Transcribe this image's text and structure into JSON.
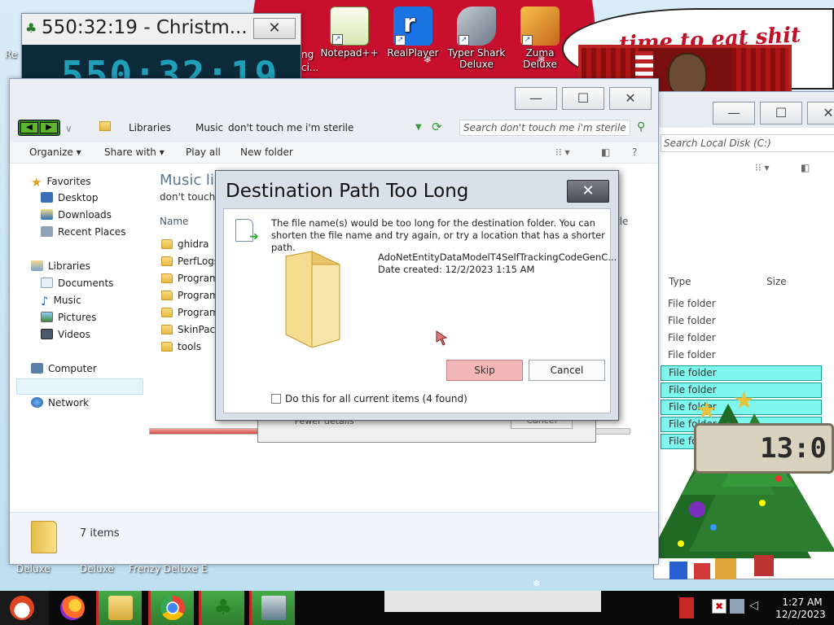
{
  "timer_widget": {
    "title": "550:32:19 - Christm...",
    "display": "550:32:19",
    "close_glyph": "✕"
  },
  "desktop_icons": [
    {
      "label": "Notepad++",
      "icon": "notepad-plus-plus-icon",
      "color": "#6aa84f"
    },
    {
      "label": "RealPlayer",
      "icon": "realplayer-icon",
      "color": "#1b74e4"
    },
    {
      "label": "Typer Shark Deluxe",
      "icon": "typer-shark-icon",
      "color": "#8a96a3"
    },
    {
      "label": "Zuma Deluxe",
      "icon": "zuma-deluxe-icon",
      "color": "#e08a2a"
    }
  ],
  "desktop_partial_labels": [
    "Re",
    "ng",
    "ci..."
  ],
  "bottom_icon_labels": [
    "Deluxe",
    "Deluxe",
    "Frenzy Deluxe",
    "E"
  ],
  "bubble_text": "time to eat shit",
  "back_window": {
    "search_placeholder": "Search Local Disk (C:)",
    "columns": [
      "Type",
      "Size"
    ],
    "rows": [
      {
        "type": "File folder",
        "selected": false
      },
      {
        "type": "File folder",
        "selected": false
      },
      {
        "type": "File folder",
        "selected": false
      },
      {
        "type": "File folder",
        "selected": false
      },
      {
        "type": "File folder",
        "selected": true
      },
      {
        "type": "File folder",
        "selected": true
      },
      {
        "type": "File folder",
        "selected": true
      },
      {
        "type": "File folder",
        "selected": true
      },
      {
        "type": "File folder",
        "selected": true
      }
    ],
    "selection_color": "#7ef7ee"
  },
  "main_window": {
    "breadcrumb": [
      "Libraries",
      "Music",
      "don't touch me i'm sterile"
    ],
    "search_placeholder": "Search don't touch me i'm sterile",
    "toolbar": {
      "organize": "Organize",
      "share_with": "Share with",
      "play_all": "Play all",
      "new_folder": "New folder"
    },
    "nav": {
      "favorites": "Favorites",
      "desktop": "Desktop",
      "downloads": "Downloads",
      "recent_places": "Recent Places",
      "libraries": "Libraries",
      "documents": "Documents",
      "music": "Music",
      "pictures": "Pictures",
      "videos": "Videos",
      "computer": "Computer",
      "network": "Network"
    },
    "library_title": "Music lib",
    "library_sub": "don't touch",
    "column_name": "Name",
    "column_partial": "tle",
    "files": [
      "ghidra",
      "PerfLogs",
      "Program",
      "Program",
      "Program",
      "SkinPack",
      "tools"
    ],
    "status": "7 items",
    "copy_progress": 0.88
  },
  "copy_dialog_bg": {
    "fewer_details": "Fewer details",
    "cancel": "Cancel"
  },
  "dialog": {
    "title": "Destination Path Too Long",
    "close_glyph": "✕",
    "message": "The file name(s) would be too long for the destination folder.  You can shorten the file name and try again, or try a location that has a shorter path.",
    "filename": "AdoNetEntityDataModelT4SelfTrackingCodeGenC...",
    "date_created": "Date created: 12/2/2023 1:15 AM",
    "skip": "Skip",
    "cancel": "Cancel",
    "checkbox_label": "Do this for all current items (4 found)",
    "checkbox_checked": false
  },
  "taskbar": {
    "apps": [
      {
        "icon": "santa-start-icon"
      },
      {
        "icon": "firefox-icon"
      },
      {
        "icon": "file-explorer-icon",
        "active": true
      },
      {
        "icon": "chrome-icon",
        "active": true
      },
      {
        "icon": "christmas-tree-app-icon",
        "active": true
      },
      {
        "icon": "system-monitor-icon",
        "active": true
      }
    ],
    "time": "1:27 AM",
    "date": "12/2/2023"
  }
}
